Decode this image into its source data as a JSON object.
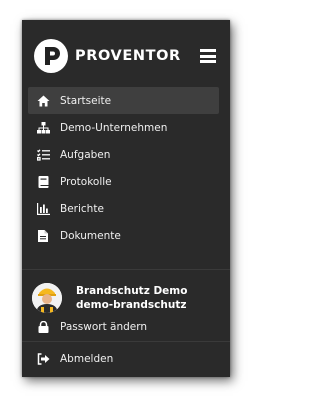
{
  "brand": {
    "name": "PROVENTOR",
    "logo_letter": "P"
  },
  "menu_icon": "hamburger-icon",
  "nav": [
    {
      "label": "Startseite",
      "icon": "home-icon",
      "active": true
    },
    {
      "label": "Demo-Unternehmen",
      "icon": "sitemap-icon"
    },
    {
      "label": "Aufgaben",
      "icon": "tasks-icon"
    },
    {
      "label": "Protokolle",
      "icon": "book-icon"
    },
    {
      "label": "Berichte",
      "icon": "bar-chart-icon"
    },
    {
      "label": "Dokumente",
      "icon": "document-icon"
    }
  ],
  "user": {
    "company": "Brandschutz Demo",
    "username": "demo-brandschutz"
  },
  "password_label": "Passwort ändern",
  "logout_label": "Abmelden",
  "colors": {
    "panel": "#2a2a2a",
    "active": "#3f3f3f",
    "text": "#ffffff"
  }
}
